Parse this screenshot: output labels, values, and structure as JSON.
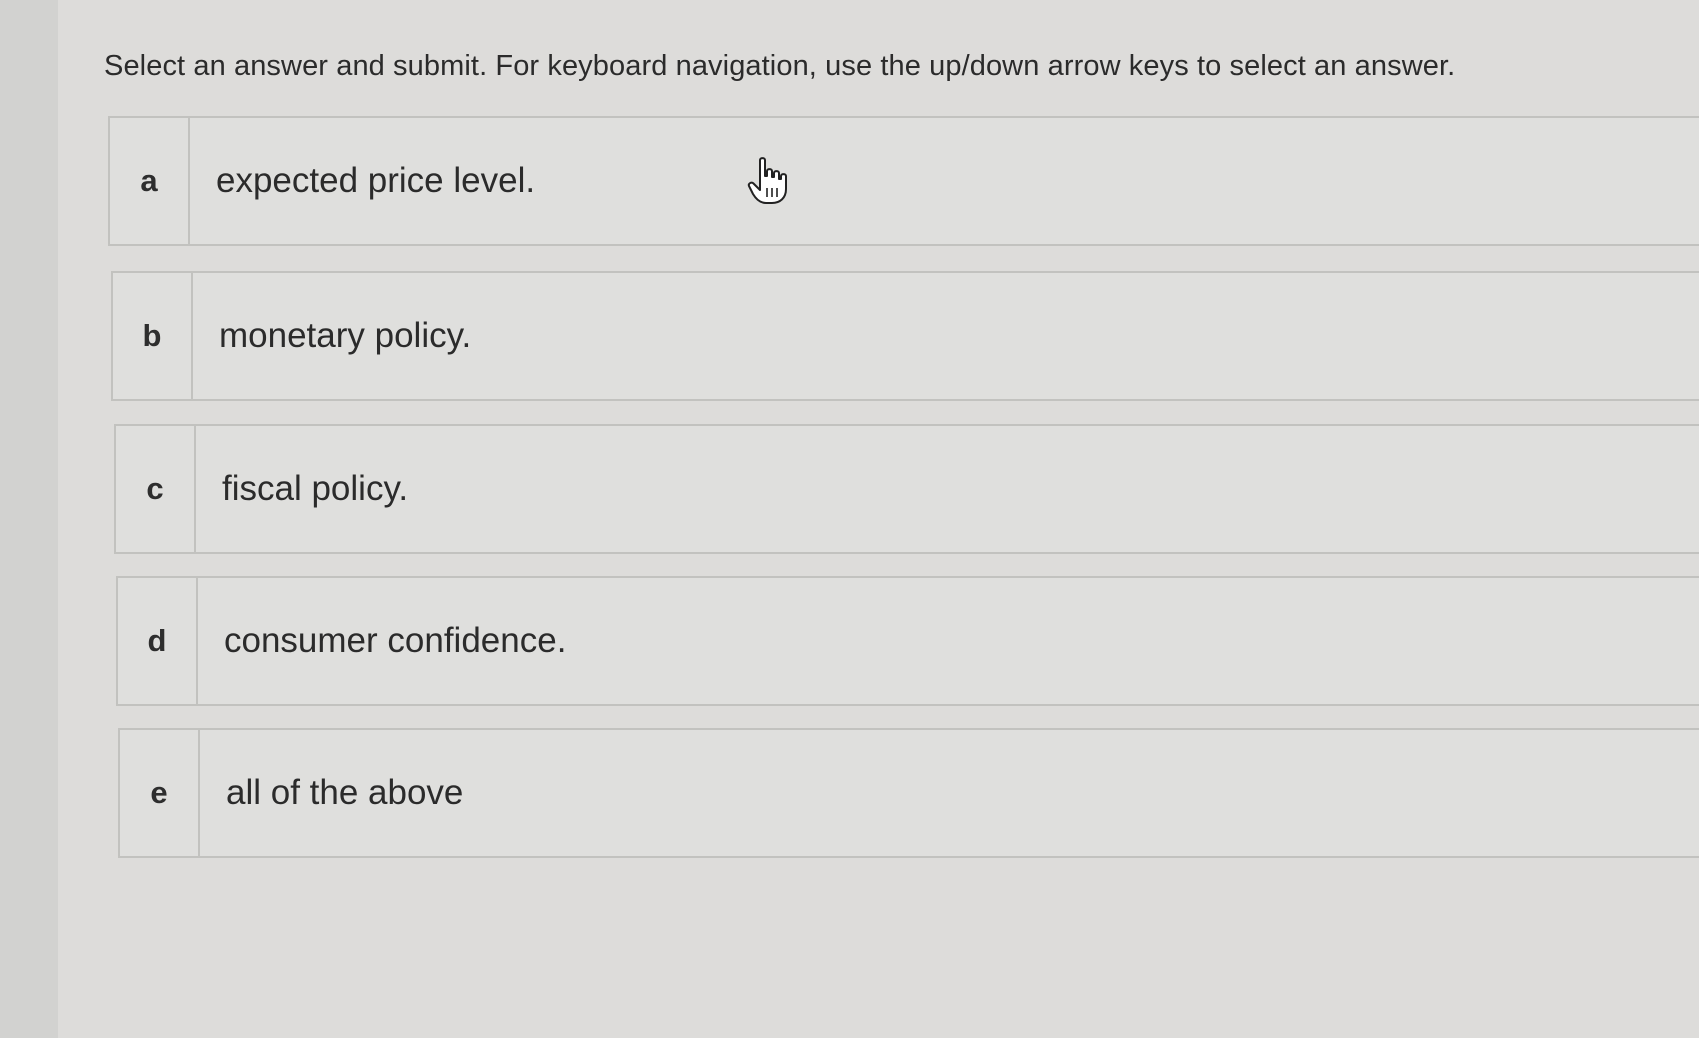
{
  "question": {
    "instructions": "Select an answer and submit. For keyboard navigation, use the up/down arrow keys to select an answer."
  },
  "options": [
    {
      "letter": "a",
      "text": "expected price level."
    },
    {
      "letter": "b",
      "text": "monetary policy."
    },
    {
      "letter": "c",
      "text": "fiscal policy."
    },
    {
      "letter": "d",
      "text": "consumer confidence."
    },
    {
      "letter": "e",
      "text": "all of the above"
    }
  ],
  "cursor": {
    "icon": "hand-pointer-icon"
  },
  "colors": {
    "background": "#dddcda",
    "border": "#c2c2bf",
    "text": "#2b2b2b"
  }
}
